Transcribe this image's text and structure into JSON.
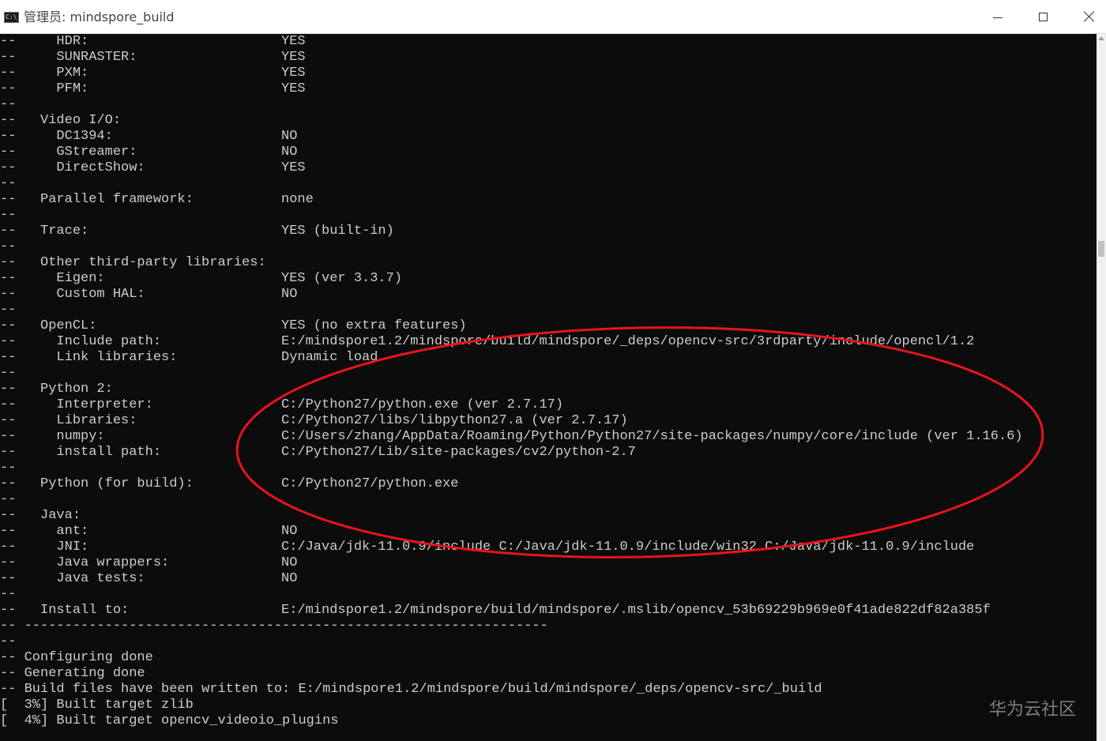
{
  "window": {
    "title": "管理员: mindspore_build",
    "icon": "cmd-icon",
    "icon_text": "C:\\_",
    "controls": [
      "minimize-icon",
      "maximize-icon",
      "close-icon"
    ]
  },
  "console": {
    "lines": [
      {
        "a": "--     HDR:",
        "b": "YES"
      },
      {
        "a": "--     SUNRASTER:",
        "b": "YES"
      },
      {
        "a": "--     PXM:",
        "b": "YES"
      },
      {
        "a": "--     PFM:",
        "b": "YES"
      },
      {
        "a": "--",
        "b": ""
      },
      {
        "a": "--   Video I/O:",
        "b": ""
      },
      {
        "a": "--     DC1394:",
        "b": "NO"
      },
      {
        "a": "--     GStreamer:",
        "b": "NO"
      },
      {
        "a": "--     DirectShow:",
        "b": "YES"
      },
      {
        "a": "--",
        "b": ""
      },
      {
        "a": "--   Parallel framework:",
        "b": "none"
      },
      {
        "a": "--",
        "b": ""
      },
      {
        "a": "--   Trace:",
        "b": "YES (built-in)"
      },
      {
        "a": "--",
        "b": ""
      },
      {
        "a": "--   Other third-party libraries:",
        "b": ""
      },
      {
        "a": "--     Eigen:",
        "b": "YES (ver 3.3.7)"
      },
      {
        "a": "--     Custom HAL:",
        "b": "NO"
      },
      {
        "a": "--",
        "b": ""
      },
      {
        "a": "--   OpenCL:",
        "b": "YES (no extra features)"
      },
      {
        "a": "--     Include path:",
        "b": "E:/mindspore1.2/mindspore/build/mindspore/_deps/opencv-src/3rdparty/include/opencl/1.2"
      },
      {
        "a": "--     Link libraries:",
        "b": "Dynamic load"
      },
      {
        "a": "--",
        "b": ""
      },
      {
        "a": "--   Python 2:",
        "b": ""
      },
      {
        "a": "--     Interpreter:",
        "b": "C:/Python27/python.exe (ver 2.7.17)"
      },
      {
        "a": "--     Libraries:",
        "b": "C:/Python27/libs/libpython27.a (ver 2.7.17)"
      },
      {
        "a": "--     numpy:",
        "b": "C:/Users/zhang/AppData/Roaming/Python/Python27/site-packages/numpy/core/include (ver 1.16.6)"
      },
      {
        "a": "--     install path:",
        "b": "C:/Python27/Lib/site-packages/cv2/python-2.7"
      },
      {
        "a": "--",
        "b": ""
      },
      {
        "a": "--   Python (for build):",
        "b": "C:/Python27/python.exe"
      },
      {
        "a": "--",
        "b": ""
      },
      {
        "a": "--   Java:",
        "b": ""
      },
      {
        "a": "--     ant:",
        "b": "NO"
      },
      {
        "a": "--     JNI:",
        "b": "C:/Java/jdk-11.0.9/include C:/Java/jdk-11.0.9/include/win32 C:/Java/jdk-11.0.9/include"
      },
      {
        "a": "--     Java wrappers:",
        "b": "NO"
      },
      {
        "a": "--     Java tests:",
        "b": "NO"
      },
      {
        "a": "--",
        "b": ""
      },
      {
        "a": "--   Install to:",
        "b": "E:/mindspore1.2/mindspore/build/mindspore/.mslib/opencv_53b69229b969e0f41ade822df82a385f"
      },
      {
        "a": "-- -----------------------------------------------------------------",
        "b": ""
      },
      {
        "a": "--",
        "b": ""
      },
      {
        "a": "-- Configuring done",
        "b": ""
      },
      {
        "a": "-- Generating done",
        "b": ""
      },
      {
        "a": "-- Build files have been written to: E:/mindspore1.2/mindspore/build/mindspore/_deps/opencv-src/_build",
        "b": ""
      },
      {
        "a": "[  3%] Built target zlib",
        "b": ""
      },
      {
        "a": "[  4%] Built target opencv_videoio_plugins",
        "b": ""
      }
    ]
  },
  "annotation": {
    "shape": "ellipse",
    "color": "#e8141c"
  },
  "watermark": {
    "text": "华为云社区"
  },
  "colors": {
    "console_bg": "#0c0c0c",
    "console_fg": "#cccccc",
    "titlebar_bg": "#ffffff"
  }
}
